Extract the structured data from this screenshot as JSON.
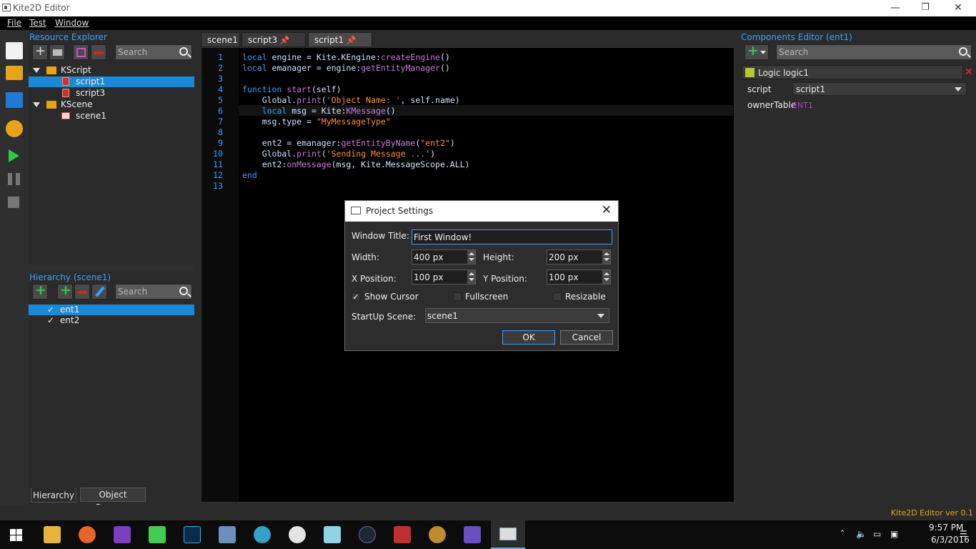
{
  "window": {
    "title": "Kite2D Editor",
    "minimize": "—",
    "maximize": "❐",
    "close": "✕"
  },
  "menu": {
    "file": "File",
    "test": "Test",
    "window": "Window"
  },
  "resource_explorer": {
    "title": "Resource Explorer",
    "search_placeholder": "Search",
    "tree": {
      "kscript": "KScript",
      "script1": "script1",
      "script3": "script3",
      "kscene": "KScene",
      "scene1": "scene1"
    }
  },
  "hierarchy": {
    "title": "Hierarchy (scene1)",
    "search_placeholder": "Search",
    "items": [
      {
        "label": "ent1",
        "check": "✓"
      },
      {
        "label": "ent2",
        "check": "✓"
      }
    ],
    "tabs": {
      "hierarchy": "Hierarchy",
      "object_browser": "Object Browser"
    }
  },
  "editor_tabs": [
    {
      "label": "scene1"
    },
    {
      "label": "script3"
    },
    {
      "label": "script1"
    }
  ],
  "code": {
    "line_numbers": [
      "1",
      "2",
      "3",
      "4",
      "5",
      "6",
      "7",
      "8",
      "9",
      "10",
      "11",
      "12",
      "13"
    ]
  },
  "components": {
    "title": "Components Editor (ent1)",
    "search_placeholder": "Search",
    "component_name": "Logic logic1",
    "script_label": "script",
    "script_value": "script1",
    "owner_label": "ownerTable",
    "owner_value": "ENT1"
  },
  "dialog": {
    "title": "Project Settings",
    "window_title_label": "Window Title:",
    "window_title_value": "First Window!",
    "width_label": "Width:",
    "width_value": "400 px",
    "height_label": "Height:",
    "height_value": "200 px",
    "xpos_label": "X Position:",
    "xpos_value": "100 px",
    "ypos_label": "Y Position:",
    "ypos_value": "100 px",
    "show_cursor_label": "Show Cursor",
    "show_cursor_check": "✓",
    "fullscreen_label": "Fullscreen",
    "resizable_label": "Resizable",
    "startup_label": "StartUp Scene:",
    "startup_value": "scene1",
    "ok": "OK",
    "cancel": "Cancel"
  },
  "status": {
    "version": "Kite2D Editor ver 0.1"
  },
  "taskbar": {
    "time": "9:57 PM",
    "date": "6/3/2016"
  },
  "colors": {
    "accent": "#1b8ad6",
    "title_blue": "#3aa0ff",
    "close_red": "#ff2b2b"
  }
}
